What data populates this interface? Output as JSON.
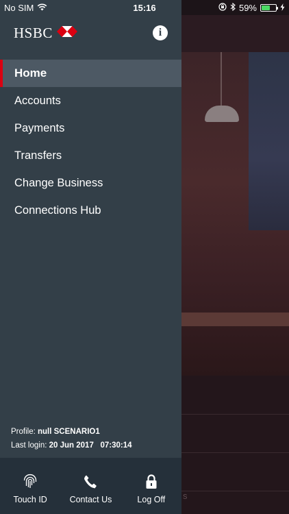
{
  "status_bar": {
    "carrier": "No SIM",
    "time": "15:16",
    "battery_percent": "59%",
    "battery_level": 0.59,
    "icons": [
      "wifi-icon",
      "orientation-lock-icon",
      "bluetooth-icon",
      "battery-icon",
      "charging-bolt-icon"
    ]
  },
  "drawer": {
    "logo_text": "HSBC",
    "logo_icon": "hsbc-hexagon-logo",
    "info_icon": "info-icon",
    "nav_items": [
      {
        "label": "Home",
        "active": true
      },
      {
        "label": "Accounts",
        "active": false
      },
      {
        "label": "Payments",
        "active": false
      },
      {
        "label": "Transfers",
        "active": false
      },
      {
        "label": "Change Business",
        "active": false
      },
      {
        "label": "Connections Hub",
        "active": false
      }
    ],
    "profile": {
      "profile_label": "Profile:",
      "profile_value": "null SCENARIO1",
      "login_label": "Last login:",
      "login_date": "20 Jun 2017",
      "login_time": "07:30:14"
    },
    "bottom_bar": [
      {
        "label": "Touch ID",
        "icon": "fingerprint-icon"
      },
      {
        "label": "Contact Us",
        "icon": "phone-icon"
      },
      {
        "label": "Log Off",
        "icon": "lock-icon"
      }
    ]
  },
  "background": {
    "partial_label": "s"
  },
  "colors": {
    "drawer_bg": "#333f48",
    "active_item_bg": "#4d5964",
    "accent_red": "#db0011",
    "bottom_bar_bg": "#25303a"
  }
}
